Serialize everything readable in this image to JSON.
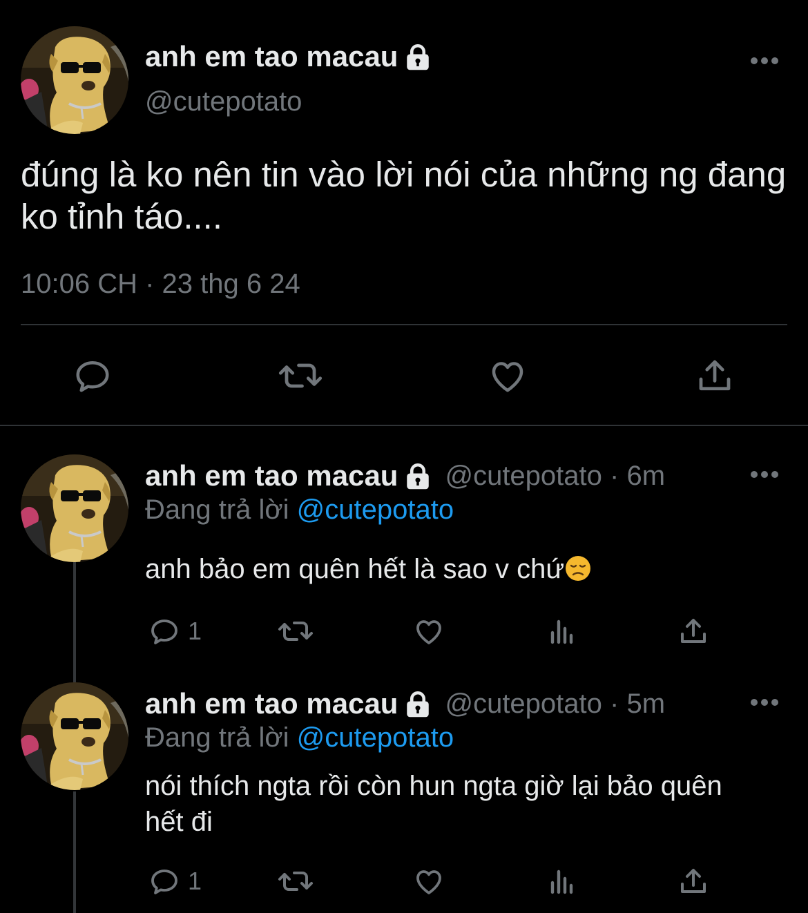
{
  "main_tweet": {
    "display_name": "anh em tao macau",
    "handle": "@cutepotato",
    "text": "đúng là ko nên tin vào lời nói của những ng đang ko tỉnh táo....",
    "timestamp": "10:06 CH · 23 thg 6 24",
    "actions": [
      "reply-icon",
      "retweet-icon",
      "like-icon",
      "share-icon"
    ]
  },
  "replies": [
    {
      "display_name": "anh em tao macau",
      "handle": "@cutepotato",
      "time": "6m",
      "replying_prefix": "Đang trả lời",
      "replying_to": "@cutepotato",
      "text": "anh bảo em quên hết là sao v chứ",
      "emoji": "disappointed-face",
      "reply_count": "1"
    },
    {
      "display_name": "anh em tao macau",
      "handle": "@cutepotato",
      "time": "5m",
      "replying_prefix": "Đang trả lời",
      "replying_to": "@cutepotato",
      "text": "nói thích ngta rồi còn hun ngta giờ lại bảo quên hết đi",
      "reply_count": "1"
    }
  ],
  "colors": {
    "background": "#000000",
    "text_primary": "#e7e9ea",
    "text_secondary": "#71767b",
    "accent": "#1d9bf0",
    "divider": "#2f3336"
  }
}
